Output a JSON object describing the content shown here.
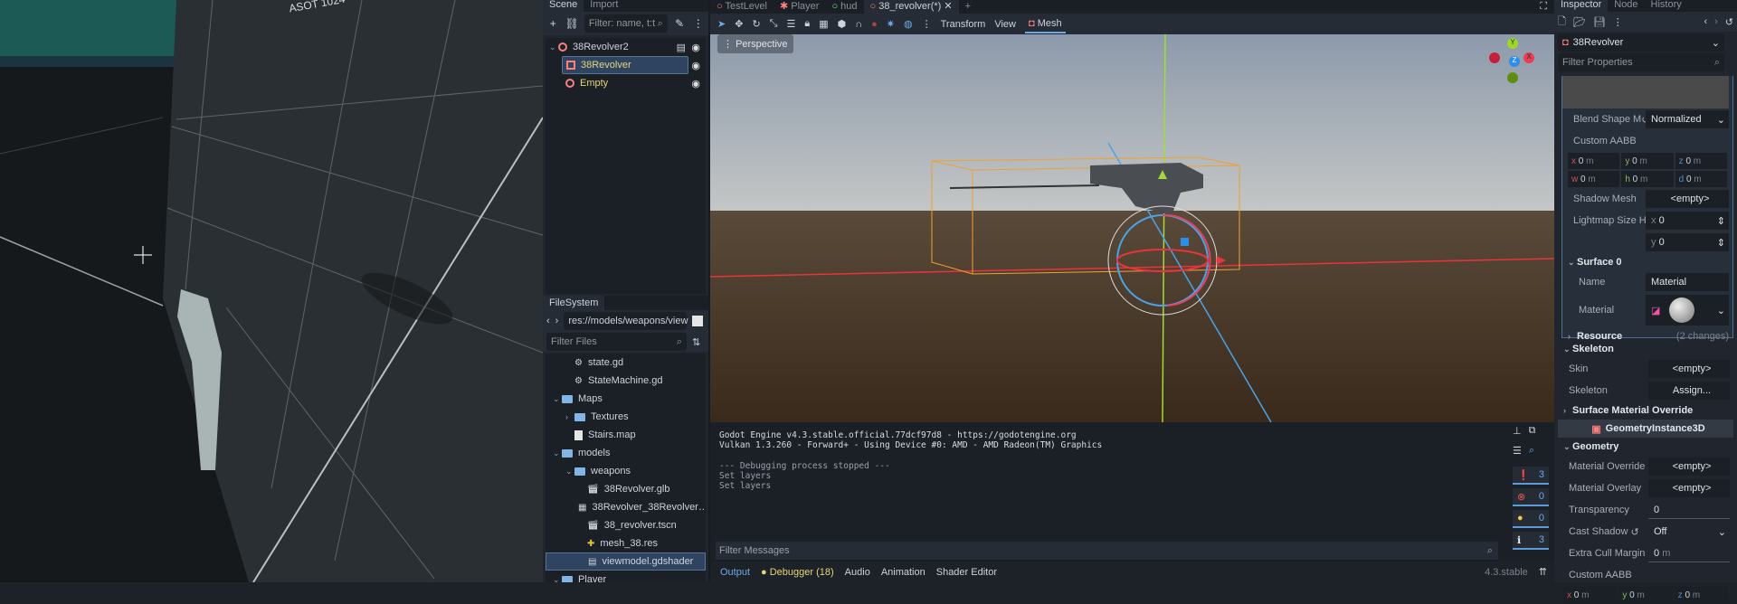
{
  "game_view": {
    "wall_text": "ASOT 1024"
  },
  "scene_dock": {
    "tabs": [
      "Scene",
      "Import"
    ],
    "filter_placeholder": "Filter: name, t:t",
    "tree": [
      {
        "label": "38Revolver2",
        "color": "#cdd3dc",
        "icon": "node3d-icon"
      },
      {
        "label": "38Revolver",
        "color": "#e6d57a",
        "icon": "mesh-instance-icon",
        "selected": true
      },
      {
        "label": "Empty",
        "color": "#e6d57a",
        "icon": "node3d-icon"
      }
    ]
  },
  "filesystem": {
    "tab": "FileSystem",
    "path": "res://models/weapons/view",
    "filter_placeholder": "Filter Files",
    "items": [
      {
        "label": "state.gd",
        "icon": "gear-icon",
        "indent": 1
      },
      {
        "label": "StateMachine.gd",
        "icon": "gear-icon",
        "indent": 1
      },
      {
        "label": "Maps",
        "icon": "folder-icon",
        "indent": 0,
        "expanded": true
      },
      {
        "label": "Textures",
        "icon": "folder-icon",
        "indent": 1,
        "collapsed": true
      },
      {
        "label": "Stairs.map",
        "icon": "file-icon",
        "indent": 1
      },
      {
        "label": "models",
        "icon": "folder-icon",
        "indent": 0,
        "expanded": true
      },
      {
        "label": "weapons",
        "icon": "folder-icon",
        "indent": 1,
        "expanded": true
      },
      {
        "label": "38Revolver.glb",
        "icon": "scene-icon",
        "indent": 2
      },
      {
        "label": "38Revolver_38Revolver…",
        "icon": "image-icon",
        "indent": 2
      },
      {
        "label": "38_revolver.tscn",
        "icon": "scene-icon",
        "indent": 2
      },
      {
        "label": "mesh_38.res",
        "icon": "resource-icon",
        "indent": 2
      },
      {
        "label": "viewmodel.gdshader",
        "icon": "shader-icon",
        "indent": 2,
        "selected": true
      },
      {
        "label": "Player",
        "icon": "folder-icon",
        "indent": 0,
        "expanded": true
      }
    ]
  },
  "editor_tabs": [
    {
      "label": "TestLevel",
      "icon": "node3d-icon"
    },
    {
      "label": "Player",
      "icon": "character-icon"
    },
    {
      "label": "hud",
      "icon": "control-icon"
    },
    {
      "label": "38_revolver(*)",
      "icon": "node3d-icon",
      "active": true
    }
  ],
  "viewport": {
    "menus": [
      "Transform",
      "View",
      "Mesh"
    ],
    "perspective_label": "Perspective",
    "gizmo": {
      "y": "Y",
      "x": "X",
      "z": "Z"
    }
  },
  "output": {
    "lines": [
      "Godot Engine v4.3.stable.official.77dcf97d8 - https://godotengine.org",
      "Vulkan 1.3.260 - Forward+ - Using Device #0: AMD - AMD Radeon(TM) Graphics",
      "",
      "--- Debugging process stopped ---",
      "Set layers",
      "Set layers"
    ],
    "filter_placeholder": "Filter Messages",
    "counts": {
      "messages": "3",
      "errors": "0",
      "warnings": "0",
      "info": "3"
    },
    "bottom_tabs": [
      "Output",
      "Debugger (18)",
      "Audio",
      "Animation",
      "Shader Editor"
    ],
    "version": "4.3.stable"
  },
  "inspector": {
    "tabs": [
      "Inspector",
      "Node",
      "History"
    ],
    "node": "38Revolver",
    "filter_placeholder": "Filter Properties",
    "blend_shape_label": "Blend Shape M",
    "blend_shape_value": "Normalized",
    "custom_aabb": "Custom AABB",
    "aabb": {
      "x": "0",
      "y": "0",
      "z": "0",
      "w": "0",
      "h": "0",
      "d": "0",
      "unit": "m"
    },
    "shadow_mesh_label": "Shadow Mesh",
    "empty": "<empty>",
    "lightmap_label": "Lightmap Size Hin",
    "lightmap": {
      "x": "0",
      "y": "0"
    },
    "surface0": "Surface 0",
    "name_label": "Name",
    "name_value": "Material",
    "material_label": "Material",
    "resource": "Resource",
    "resource_changes": "(2 changes)",
    "skeleton_section": "Skeleton",
    "skin_label": "Skin",
    "skeleton_label": "Skeleton",
    "assign": "Assign...",
    "surface_override": "Surface Material Override",
    "geometry_instance": "GeometryInstance3D",
    "geometry": "Geometry",
    "material_override": "Material Override",
    "material_overlay": "Material Overlay",
    "transparency_label": "Transparency",
    "transparency": "0",
    "cast_shadow_label": "Cast Shadow",
    "cast_shadow": "Off",
    "extra_cull_label": "Extra Cull Margin",
    "extra_cull": "0",
    "custom_aabb2": "Custom AABB",
    "aabb2": {
      "x": "0",
      "y": "0",
      "z": "0"
    }
  }
}
